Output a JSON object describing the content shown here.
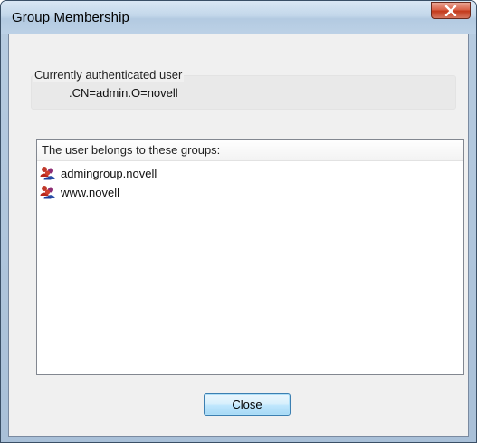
{
  "window": {
    "title": "Group Membership"
  },
  "auth_group": {
    "label": "Currently authenticated user",
    "value": ".CN=admin.O=novell"
  },
  "groups_list": {
    "header": "The user belongs to these groups:",
    "items": [
      {
        "label": "admingroup.novell",
        "icon": "user-group-icon"
      },
      {
        "label": "www.novell",
        "icon": "user-group-icon"
      }
    ]
  },
  "buttons": {
    "close_label": "Close"
  },
  "colors": {
    "title_close_button": "#c43a1c",
    "default_button_border": "#3c7fb1",
    "client_background": "#f0f0f0"
  }
}
